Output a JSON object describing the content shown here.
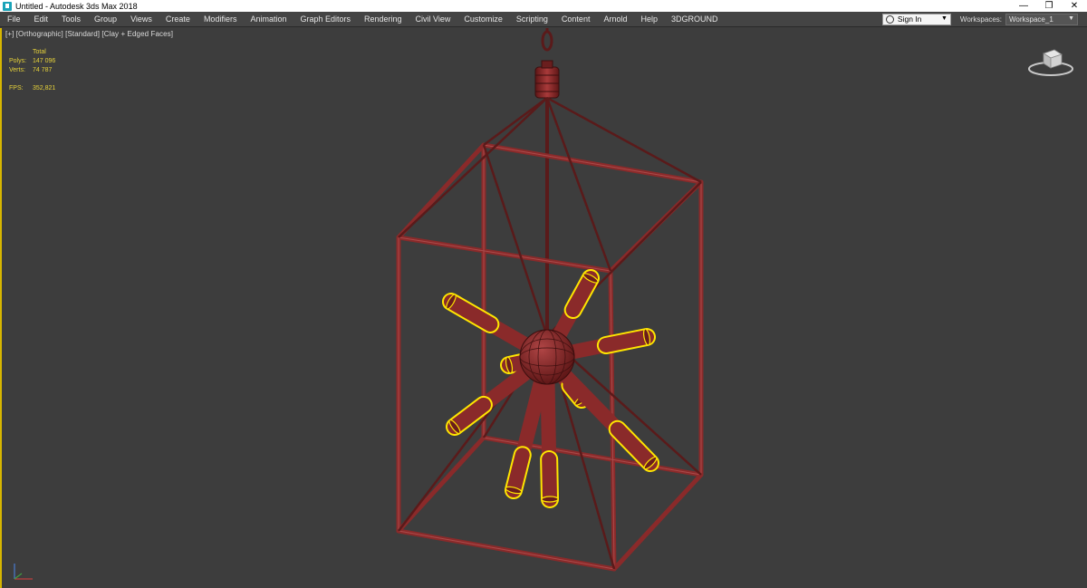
{
  "window": {
    "title": "Untitled - Autodesk 3ds Max 2018",
    "minimize": "—",
    "maximize": "❐",
    "close": "✕"
  },
  "menu": {
    "items": [
      "File",
      "Edit",
      "Tools",
      "Group",
      "Views",
      "Create",
      "Modifiers",
      "Animation",
      "Graph Editors",
      "Rendering",
      "Civil View",
      "Customize",
      "Scripting",
      "Content",
      "Arnold",
      "Help",
      "3DGROUND"
    ],
    "signin": "Sign In",
    "workspaces_label": "Workspaces:",
    "workspace_value": "Workspace_1"
  },
  "viewport": {
    "label": "[+] [Orthographic] [Standard] [Clay + Edged Faces]",
    "stats": {
      "header": "Total",
      "polys_label": "Polys:",
      "polys_value": "147 096",
      "verts_label": "Verts:",
      "verts_value": "74 787",
      "fps_label": "FPS:",
      "fps_value": "352,821"
    }
  },
  "colors": {
    "wire_red": "#8a2a2a",
    "wire_highlight": "#ffe600",
    "stats_text": "#e7d33a",
    "viewport_border": "#d7b600"
  }
}
